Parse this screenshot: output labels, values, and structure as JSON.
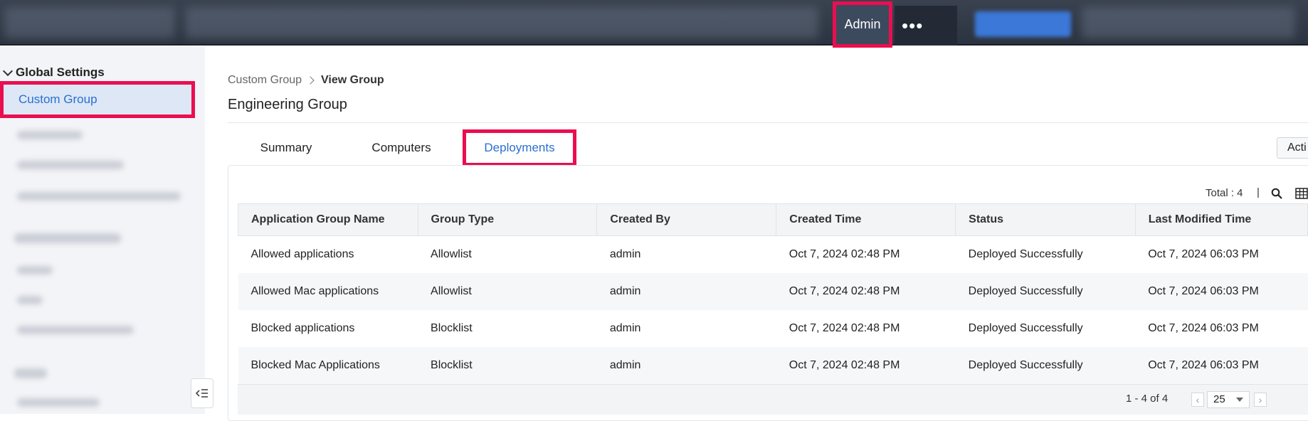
{
  "topbar": {
    "admin_label": "Admin",
    "more_label": "•••"
  },
  "sidebar": {
    "heading": "Global Settings",
    "active_item": "Custom Group",
    "collapse_icon": "collapse-sidebar-icon"
  },
  "breadcrumb": {
    "parent": "Custom Group",
    "current": "View Group"
  },
  "page_title": "Engineering Group",
  "tabs": [
    {
      "label": "Summary",
      "active": false
    },
    {
      "label": "Computers",
      "active": false
    },
    {
      "label": "Deployments",
      "active": true
    }
  ],
  "actions_label": "Acti",
  "table": {
    "total_label": "Total : 4",
    "separator": "|",
    "columns": [
      "Application Group Name",
      "Group Type",
      "Created By",
      "Created Time",
      "Status",
      "Last Modified Time"
    ],
    "rows": [
      [
        "Allowed applications",
        "Allowlist",
        "admin",
        "Oct 7, 2024 02:48 PM",
        "Deployed Successfully",
        "Oct 7, 2024 06:03 PM"
      ],
      [
        "Allowed Mac applications",
        "Allowlist",
        "admin",
        "Oct 7, 2024 02:48 PM",
        "Deployed Successfully",
        "Oct 7, 2024 06:03 PM"
      ],
      [
        "Blocked applications",
        "Blocklist",
        "admin",
        "Oct 7, 2024 02:48 PM",
        "Deployed Successfully",
        "Oct 7, 2024 06:03 PM"
      ],
      [
        "Blocked Mac Applications",
        "Blocklist",
        "admin",
        "Oct 7, 2024 02:48 PM",
        "Deployed Successfully",
        "Oct 7, 2024 06:03 PM"
      ]
    ]
  },
  "pager": {
    "range": "1 - 4 of 4",
    "page_size": "25"
  },
  "colors": {
    "highlight": "#ea0e50",
    "link": "#2a6fd1",
    "topbar": "#2c3340"
  }
}
